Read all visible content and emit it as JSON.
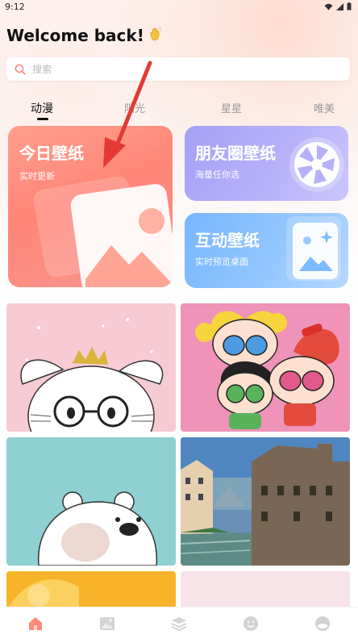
{
  "status_bar": {
    "time": "9:12"
  },
  "header": {
    "greeting": "Welcome back!",
    "wave_icon": "waving-hand-icon"
  },
  "search": {
    "placeholder": "搜索"
  },
  "tabs": [
    {
      "label": "动漫",
      "active": true
    },
    {
      "label": "阳光",
      "active": false
    },
    {
      "label": "星星",
      "active": false
    },
    {
      "label": "唯美",
      "active": false
    }
  ],
  "feature_cards": {
    "today": {
      "title": "今日壁纸",
      "subtitle": "实时更新",
      "icon": "image-icon"
    },
    "moments": {
      "title": "朋友圈壁纸",
      "subtitle": "海量任你选",
      "icon": "camera-aperture-icon"
    },
    "live": {
      "title": "互动壁纸",
      "subtitle": "实时预览桌面",
      "icon": "sparkle-image-icon"
    }
  },
  "wallpapers": [
    {
      "subject": "bunny-with-crown-and-glasses",
      "background": "#f6cbd3"
    },
    {
      "subject": "powerpuff-girls",
      "background": "#ef93b8"
    },
    {
      "subject": "white-bear",
      "background": "#8fd0d3"
    },
    {
      "subject": "canal-town-landscape",
      "background": "#6a8fb7"
    },
    {
      "subject": "yellow-abstract",
      "background": "#f7b42b"
    },
    {
      "subject": "pink-blank",
      "background": "#f8e3e8"
    }
  ],
  "bottom_nav": [
    {
      "icon": "home-icon",
      "active": true
    },
    {
      "icon": "picture-icon",
      "active": false
    },
    {
      "icon": "layers-icon",
      "active": false
    },
    {
      "icon": "smiley-icon",
      "active": false
    },
    {
      "icon": "profile-icon",
      "active": false
    }
  ],
  "colors": {
    "accent": "#ff7a6c",
    "today_card": "#ff8578",
    "moments_card": "#a6a0f7",
    "live_card": "#77b6ff",
    "nav_active": "#ff8a7a",
    "nav_inactive": "#cfcfcf",
    "annotation_arrow": "#e53935"
  }
}
